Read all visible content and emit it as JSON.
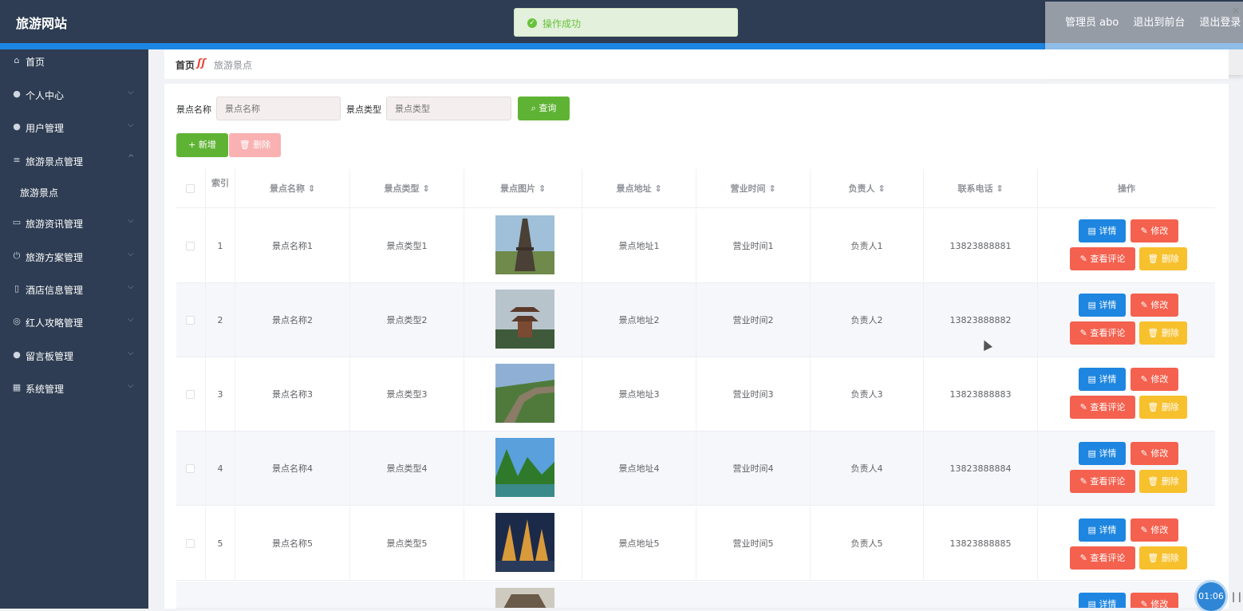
{
  "header": {
    "brand": "旅游网站",
    "user_label": "管理员 abo",
    "nav_front": "退出到前台",
    "nav_logout": "退出登录"
  },
  "toast": {
    "message": "操作成功"
  },
  "breadcrumb": {
    "home": "首页",
    "current": "旅游景点"
  },
  "sidebar": {
    "items": [
      {
        "label": "首页",
        "icon": "home-icon",
        "chevron": ""
      },
      {
        "label": "个人中心",
        "icon": "user-icon",
        "chevron": "⌵"
      },
      {
        "label": "用户管理",
        "icon": "pin-icon",
        "chevron": "⌵"
      },
      {
        "label": "旅游景点管理",
        "icon": "sliders-icon",
        "chevron": "^"
      },
      {
        "label": "旅游资讯管理",
        "icon": "message-icon",
        "chevron": "⌵"
      },
      {
        "label": "旅游方案管理",
        "icon": "power-icon",
        "chevron": "⌵"
      },
      {
        "label": "酒店信息管理",
        "icon": "building-icon",
        "chevron": "⌵"
      },
      {
        "label": "红人攻略管理",
        "icon": "compass-icon",
        "chevron": "⌵"
      },
      {
        "label": "留言板管理",
        "icon": "user-icon",
        "chevron": "⌵"
      },
      {
        "label": "系统管理",
        "icon": "grid-icon",
        "chevron": "⌵"
      }
    ],
    "sub_item": "旅游景点"
  },
  "search": {
    "name_label": "景点名称",
    "name_placeholder": "景点名称",
    "type_label": "景点类型",
    "type_placeholder": "景点类型",
    "query_button": "查询"
  },
  "toolbar": {
    "add_button": "新增",
    "delete_button": "删除"
  },
  "table": {
    "columns": [
      "索引",
      "景点名称",
      "景点类型",
      "景点图片",
      "景点地址",
      "营业时间",
      "负责人",
      "联系电话",
      "操作"
    ],
    "actions": {
      "detail": "详情",
      "edit": "修改",
      "comments": "查看评论",
      "delete": "删除"
    },
    "rows": [
      {
        "index": "1",
        "name": "景点名称1",
        "type": "景点类型1",
        "address": "景点地址1",
        "hours": "营业时间1",
        "owner": "负责人1",
        "phone": "13823888881"
      },
      {
        "index": "2",
        "name": "景点名称2",
        "type": "景点类型2",
        "address": "景点地址2",
        "hours": "营业时间2",
        "owner": "负责人2",
        "phone": "13823888882"
      },
      {
        "index": "3",
        "name": "景点名称3",
        "type": "景点类型3",
        "address": "景点地址3",
        "hours": "营业时间3",
        "owner": "负责人3",
        "phone": "13823888883"
      },
      {
        "index": "4",
        "name": "景点名称4",
        "type": "景点类型4",
        "address": "景点地址4",
        "hours": "营业时间4",
        "owner": "负责人4",
        "phone": "13823888884"
      },
      {
        "index": "5",
        "name": "景点名称5",
        "type": "景点类型5",
        "address": "景点地址5",
        "hours": "营业时间5",
        "owner": "负责人5",
        "phone": "13823888885"
      }
    ]
  },
  "overlay": {
    "timer": "01:06",
    "pause_glyph": "| |"
  },
  "colors": {
    "sidebar": "#2e3d53",
    "accent": "#1d86e4",
    "green": "#5fb334",
    "red": "#f4614f",
    "yellow": "#f7c02d",
    "blue": "#1e86e0"
  }
}
